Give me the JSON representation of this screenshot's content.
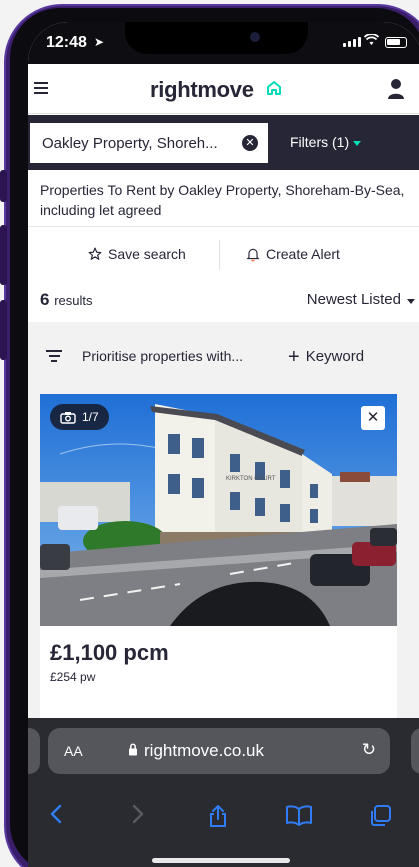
{
  "status": {
    "time": "12:48"
  },
  "header": {
    "logo": "rightmove"
  },
  "search": {
    "value": "Oakley Property, Shoreh...",
    "filters_label": "Filters (1)"
  },
  "description": "Properties To Rent by Oakley Property, Shoreham-By-Sea, including let agreed",
  "actions": {
    "save_search": "Save search",
    "create_alert": "Create Alert"
  },
  "results": {
    "count": "6",
    "label": "results",
    "sort": "Newest Listed"
  },
  "prioritise": {
    "text": "Prioritise properties with...",
    "keyword": "Keyword"
  },
  "listing": {
    "photo_counter": "1/7",
    "building_sign": "KIRKTON COURT",
    "price": "£1,100 pcm",
    "price_weekly": "£254 pw"
  },
  "browser": {
    "text_size": "AA",
    "url": "rightmove.co.uk"
  },
  "colors": {
    "brand_dark": "#262637",
    "accent": "#00deb6",
    "safari_blue": "#2f7cf6",
    "frame": "#3a1d6b"
  }
}
